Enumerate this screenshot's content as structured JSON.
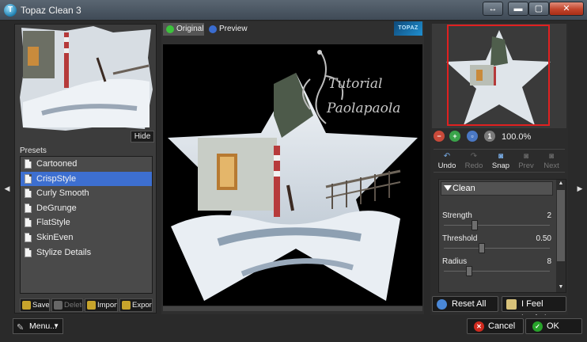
{
  "window": {
    "title": "Topaz Clean 3",
    "app_icon": "topaz-logo-icon",
    "restore_glyph": "↔",
    "minimize_glyph": "▬",
    "maximize_glyph": "▢",
    "close_glyph": "✕"
  },
  "left_panel": {
    "hide_label": "Hide",
    "presets_title": "Presets",
    "presets": [
      {
        "label": "Cartooned",
        "selected": false
      },
      {
        "label": "CrispStyle",
        "selected": true
      },
      {
        "label": "Curly Smooth",
        "selected": false
      },
      {
        "label": "DeGrunge",
        "selected": false
      },
      {
        "label": "FlatStyle",
        "selected": false
      },
      {
        "label": "SkinEven",
        "selected": false
      },
      {
        "label": "Stylize Details",
        "selected": false
      }
    ],
    "buttons": {
      "save": "Save",
      "delete": "Delete",
      "import": "Import",
      "export": "Export"
    }
  },
  "preview": {
    "tab_original": "Original",
    "tab_preview": "Preview",
    "watermark_line1": "Tutorial",
    "watermark_line2": "Paolapaola",
    "brand_logo": "TOPAZ"
  },
  "right_panel": {
    "zoom_level": "100.0%",
    "actions": {
      "undo": "Undo",
      "redo": "Redo",
      "snap": "Snap",
      "prev": "Prev",
      "next": "Next"
    },
    "section_title": "Clean",
    "sliders": [
      {
        "label": "Strength",
        "value": "2",
        "fraction": 0.28
      },
      {
        "label": "Threshold",
        "value": "0.50",
        "fraction": 0.35
      },
      {
        "label": "Radius",
        "value": "8",
        "fraction": 0.22
      }
    ],
    "reset_all": "Reset All",
    "feel_lucky": "I Feel Lucky!"
  },
  "footer": {
    "menu_label": "Menu...",
    "cancel_label": "Cancel",
    "ok_label": "OK"
  },
  "colors": {
    "selection": "#3d6fd0",
    "nav_rect": "#e02020",
    "ok_green": "#27a32a",
    "cancel_red": "#d02a1e"
  }
}
